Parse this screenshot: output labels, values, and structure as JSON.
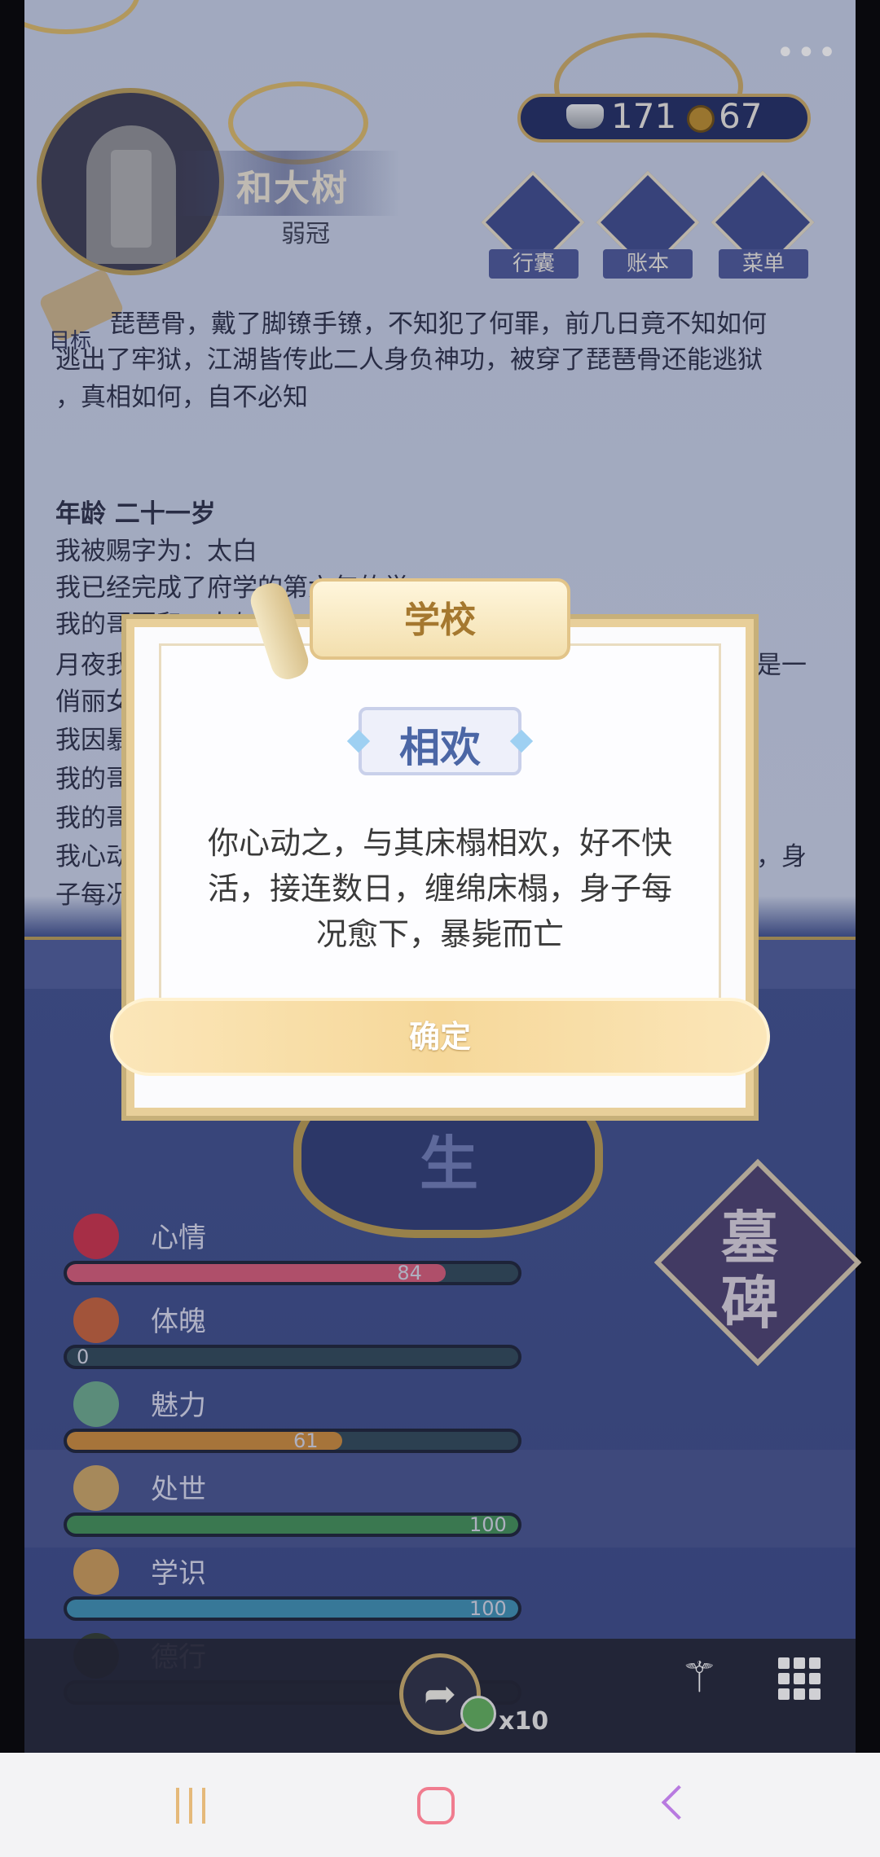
{
  "header": {
    "player_name": "和大树",
    "player_age_title": "弱冠",
    "silver": "171",
    "coins": "67",
    "menu_buttons": [
      {
        "label": "行囊"
      },
      {
        "label": "账本"
      },
      {
        "label": "菜单"
      }
    ],
    "more_dots": "•••",
    "goal_label": "目标"
  },
  "story": {
    "lines_top": [
      "琵琶骨，戴了脚镣手镣，不知犯了何罪，前几日竟不知如何",
      "逃出了牢狱，江湖皆传此二人身负神功，被穿了琵琶骨还能逃狱",
      "，真相如何，自不必知"
    ],
    "age_heading": "年龄 二十一岁",
    "lines_bottom": [
      "我被赐字为：太白",
      "我已经完成了府学的第六年的学",
      "我的哥哥和二人与",
      "月夜我",
      "俏丽女",
      "我因暴",
      "我的哥",
      "我的哥",
      "我心动",
      "子每况"
    ],
    "right_fragments": [
      "是一",
      "，身"
    ]
  },
  "center": {
    "sheng_label": "生",
    "tomb_label": "墓碑"
  },
  "stats": [
    {
      "name": "心情",
      "value": 84,
      "show": "84",
      "color": "#d55a78"
    },
    {
      "name": "体魄",
      "value": 0,
      "show": "0",
      "color": "#c98a3a"
    },
    {
      "name": "魅力",
      "value": 61,
      "show": "61",
      "color": "#c98a3a"
    },
    {
      "name": "处世",
      "value": 100,
      "show": "100",
      "color": "#3f8f57"
    },
    {
      "name": "学识",
      "value": 100,
      "show": "100",
      "color": "#3b8fb2"
    },
    {
      "name": "德行",
      "value": 0,
      "show": "",
      "color": "#6b3fa0"
    }
  ],
  "dock": {
    "share_icon": "share-icon",
    "bonus_count": "x10",
    "wand_icon": "magic-wand-icon",
    "grid_icon": "grid-menu-icon"
  },
  "modal": {
    "banner_title": "学校",
    "event_title": "相欢",
    "body_lines": [
      "你心动之，与其床榻相欢，好不快",
      "活，接连数日，缠绵床榻，身子每",
      "况愈下，暴毙而亡"
    ],
    "confirm_label": "确定"
  }
}
